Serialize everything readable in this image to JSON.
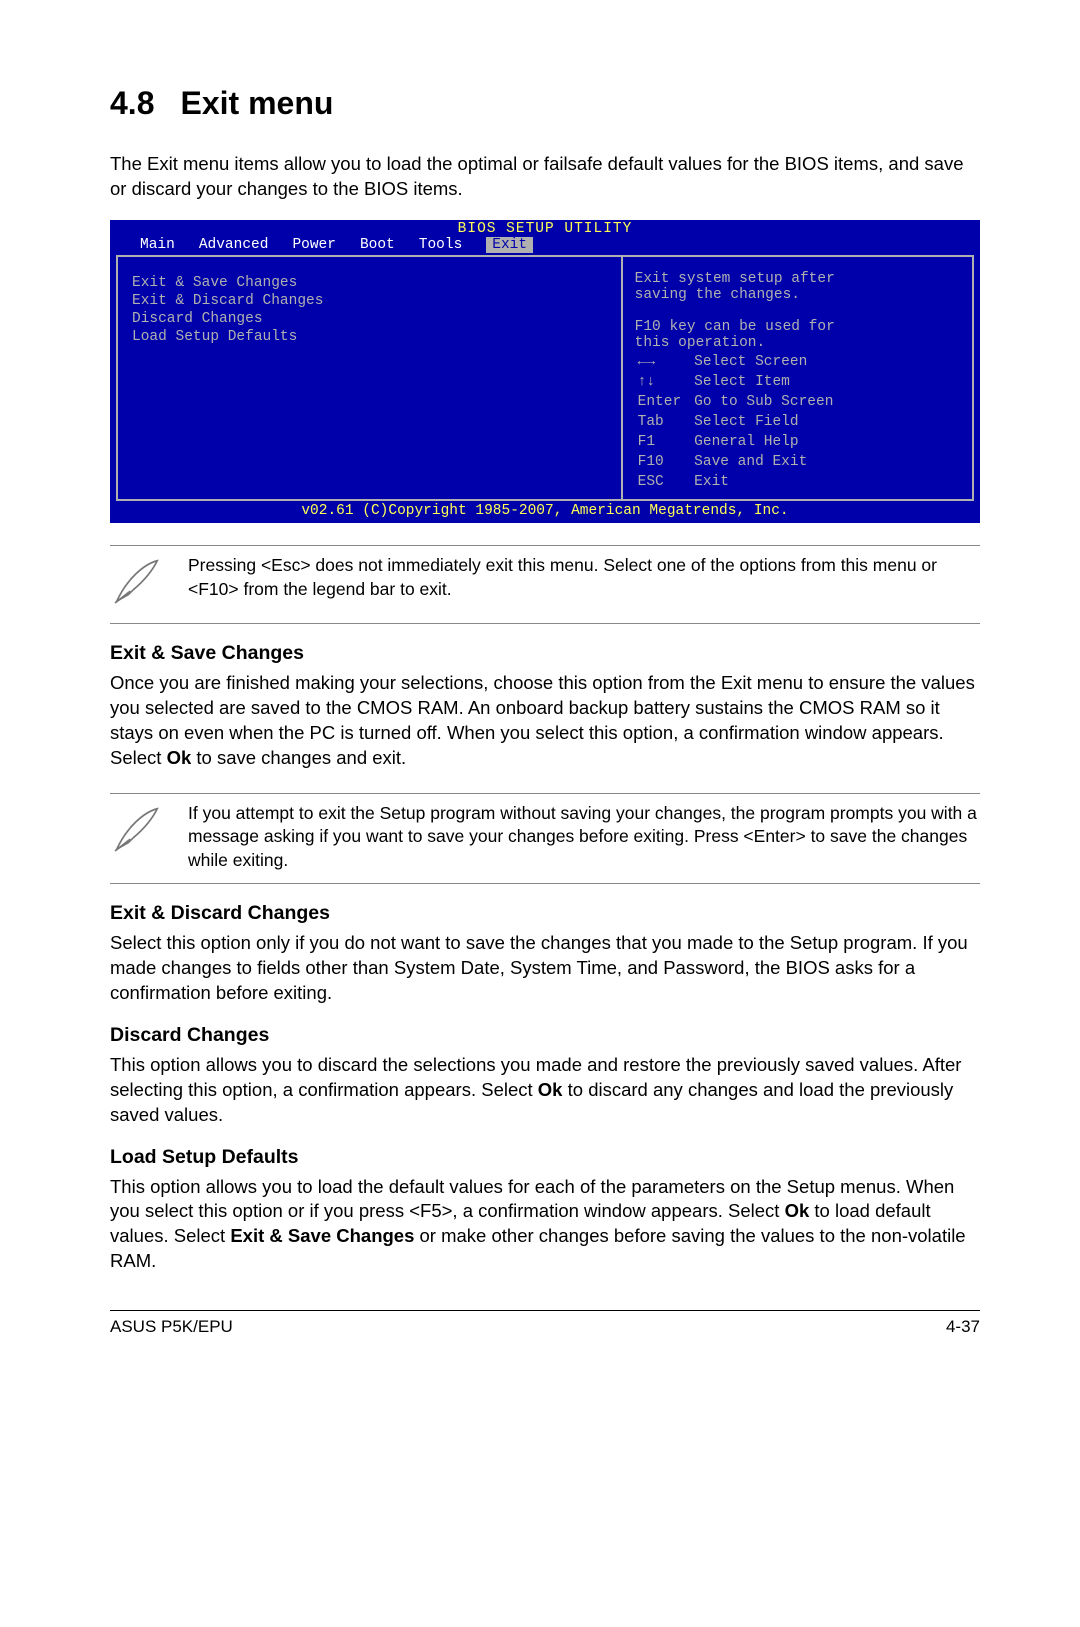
{
  "section": {
    "number": "4.8",
    "title": "Exit menu"
  },
  "intro": "The Exit menu items allow you to load the optimal or failsafe default values for the BIOS items, and save or discard your changes to the BIOS items.",
  "bios": {
    "title": "BIOS SETUP UTILITY",
    "tabs": [
      "Main",
      "Advanced",
      "Power",
      "Boot",
      "Tools",
      "Exit"
    ],
    "selected_tab": "Exit",
    "menu_items": [
      "Exit & Save Changes",
      "Exit & Discard Changes",
      "Discard Changes",
      "",
      "Load Setup Defaults"
    ],
    "help_line1": "Exit system setup after",
    "help_line2": "saving the changes.",
    "help_line3": "F10 key can be used for",
    "help_line4": "this operation.",
    "legend": [
      {
        "key": "←→",
        "desc": "Select Screen"
      },
      {
        "key": "↑↓",
        "desc": "Select Item"
      },
      {
        "key": "Enter",
        "desc": "Go to Sub Screen"
      },
      {
        "key": "Tab",
        "desc": "Select Field"
      },
      {
        "key": "F1",
        "desc": "General Help"
      },
      {
        "key": "F10",
        "desc": "Save and Exit"
      },
      {
        "key": "ESC",
        "desc": "Exit"
      }
    ],
    "footer": "v02.61 (C)Copyright 1985-2007, American Megatrends, Inc."
  },
  "note1": "Pressing <Esc> does not immediately exit this menu. Select one of the options from this menu or <F10> from the legend bar to exit.",
  "sections": {
    "s1": {
      "h": "Exit & Save Changes",
      "p_pre": "Once you are finished making your selections, choose this option from the Exit menu to ensure the values you selected are saved to the CMOS RAM. An onboard backup battery sustains the CMOS RAM so it stays on even when the PC is turned off. When you select this option, a confirmation window appears. Select ",
      "ok": "Ok",
      "p_post": " to save changes and exit."
    },
    "note2": "If you attempt to exit the Setup program without saving your changes, the program prompts you with a message asking if you want to save your changes before exiting. Press <Enter> to save the changes while exiting.",
    "s2": {
      "h": "Exit & Discard Changes",
      "p": "Select this option only if you do not want to save the changes that you  made to the Setup program. If you made changes to fields other than System Date, System Time, and Password, the BIOS asks for a confirmation before exiting."
    },
    "s3": {
      "h": "Discard Changes",
      "p_pre": "This option allows you to discard the selections you made and restore the previously saved values. After selecting this option, a confirmation appears. Select ",
      "ok": "Ok",
      "p_post": " to discard any changes and load the previously saved values."
    },
    "s4": {
      "h": "Load Setup Defaults",
      "p_pre": "This option allows you to load the default values for each of the parameters on the Setup menus. When you select this option or if you press <F5>, a confirmation window appears. Select ",
      "ok": "Ok",
      "p_mid": " to load default values. Select ",
      "exit_save": "Exit & Save Changes",
      "p_post": " or make other changes before saving the values to the non-volatile RAM."
    }
  },
  "footer": {
    "left": "ASUS P5K/EPU",
    "right": "4-37"
  }
}
